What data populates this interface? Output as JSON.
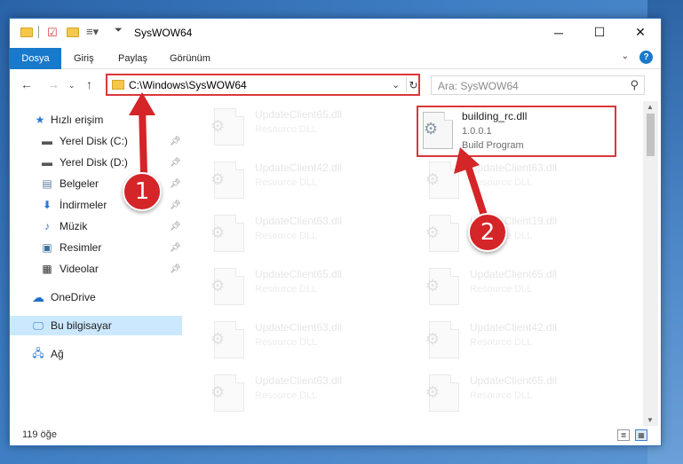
{
  "window": {
    "title": "SysWOW64",
    "buttons": {
      "minimize": "─",
      "maximize": "☐",
      "close": "✕"
    }
  },
  "ribbon": {
    "tabs": [
      "Dosya",
      "Giriş",
      "Paylaş",
      "Görünüm"
    ],
    "help": "?",
    "collapse": "⌄"
  },
  "address": {
    "path": "C:\\Windows\\SysWOW64",
    "search_placeholder": "Ara: SysWOW64"
  },
  "nav": {
    "items": [
      {
        "label": "Hızlı erişim",
        "icon": "star-icon",
        "pinned": false
      },
      {
        "label": "Yerel Disk (C:)",
        "icon": "drive-icon",
        "pinned": true
      },
      {
        "label": "Yerel Disk (D:)",
        "icon": "drive-icon",
        "pinned": true
      },
      {
        "label": "Belgeler",
        "icon": "document-icon",
        "pinned": true
      },
      {
        "label": "İndirmeler",
        "icon": "download-icon",
        "pinned": true
      },
      {
        "label": "Müzik",
        "icon": "music-icon",
        "pinned": true
      },
      {
        "label": "Resimler",
        "icon": "pictures-icon",
        "pinned": true
      },
      {
        "label": "Videolar",
        "icon": "video-icon",
        "pinned": true
      },
      {
        "label": "OneDrive",
        "icon": "cloud-icon",
        "pinned": false
      },
      {
        "label": "Bu bilgisayar",
        "icon": "computer-icon",
        "pinned": false,
        "selected": true
      },
      {
        "label": "Ağ",
        "icon": "network-icon",
        "pinned": false
      }
    ]
  },
  "files": {
    "highlighted": {
      "name": "building_rc.dll",
      "version": "1.0.0.1",
      "type": "Build Program"
    },
    "left_column": [
      {
        "name": "UpdateClient65.dll",
        "type": "Resource DLL"
      },
      {
        "name": "UpdateClient42.dll",
        "type": "Resource DLL"
      },
      {
        "name": "UpdateClient63.dll",
        "type": "Resource DLL"
      },
      {
        "name": "UpdateClient65.dll",
        "type": "Resource DLL"
      },
      {
        "name": "UpdateClient63.dll",
        "type": "Resource DLL"
      },
      {
        "name": "UpdateClient63.dll",
        "type": "Resource DLL"
      }
    ],
    "right_column": [
      {
        "name": "UpdateClient63.dll",
        "type": "Resource DLL"
      },
      {
        "name": "UpdateClient19.dll",
        "type": "Resource DLL"
      },
      {
        "name": "UpdateClient65.dll",
        "type": "Resource DLL"
      },
      {
        "name": "UpdateClient42.dll",
        "type": "Resource DLL"
      },
      {
        "name": "UpdateClient65.dll",
        "type": "Resource DLL"
      }
    ]
  },
  "status": {
    "count": "119 öğe"
  },
  "callouts": [
    "1",
    "2"
  ],
  "colors": {
    "accent": "#1979ca",
    "highlight": "#d9373b",
    "selected": "#cce8ff"
  }
}
